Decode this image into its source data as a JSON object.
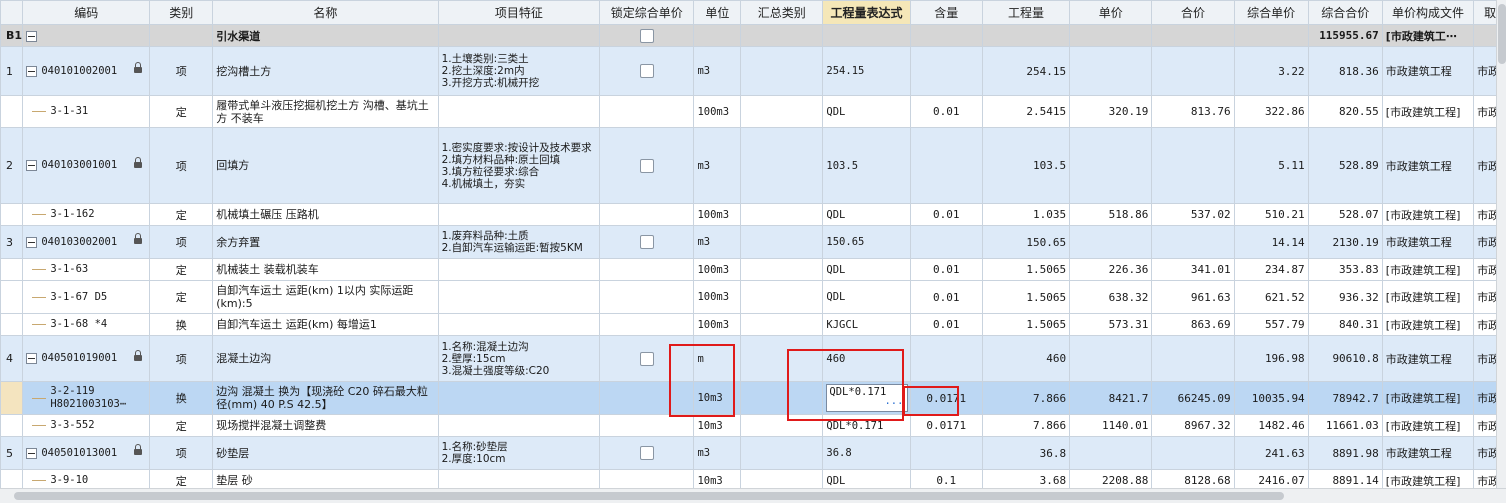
{
  "headers": [
    "编码",
    "类别",
    "名称",
    "项目特征",
    "锁定综合单价",
    "单位",
    "汇总类别",
    "工程量表达式",
    "含量",
    "工程量",
    "单价",
    "合价",
    "综合单价",
    "综合合价",
    "单价构成文件",
    "取费"
  ],
  "group": {
    "seq": "B1",
    "name": "引水渠道",
    "total": "115955.67",
    "file": "[市政建筑工⋯"
  },
  "rows": [
    {
      "seq": "1",
      "code": "040101002001",
      "type": "项",
      "name": "挖沟槽土方",
      "spec": "1.土壤类别:三类土\n2.挖土深度:2m内\n3.开挖方式:机械开挖",
      "unit": "m3",
      "expr": "254.15",
      "content": "",
      "qty": "254.15",
      "price": "",
      "total": "",
      "unitprice": "3.22",
      "uptotal": "818.36",
      "file": "市政建筑工程",
      "fee": "市政建"
    },
    {
      "code": "3-1-31",
      "type": "定",
      "name": "履带式单斗液压挖掘机挖土方 沟槽、基坑土方 不装车",
      "unit": "100m3",
      "expr": "QDL",
      "content": "0.01",
      "qty": "2.5415",
      "price": "320.19",
      "total": "813.76",
      "unitprice": "322.86",
      "uptotal": "820.55",
      "file": "[市政建筑工程]",
      "fee": "市政建"
    },
    {
      "seq": "2",
      "code": "040103001001",
      "type": "项",
      "name": "回填方",
      "spec": "1.密实度要求:按设计及技术要求\n2.填方材料品种:原土回填\n3.填方粒径要求:综合\n4.机械填土，夯实",
      "unit": "m3",
      "expr": "103.5",
      "content": "",
      "qty": "103.5",
      "price": "",
      "total": "",
      "unitprice": "5.11",
      "uptotal": "528.89",
      "file": "市政建筑工程",
      "fee": "市政建"
    },
    {
      "code": "3-1-162",
      "type": "定",
      "name": "机械填土碾压 压路机",
      "unit": "100m3",
      "expr": "QDL",
      "content": "0.01",
      "qty": "1.035",
      "price": "518.86",
      "total": "537.02",
      "unitprice": "510.21",
      "uptotal": "528.07",
      "file": "[市政建筑工程]",
      "fee": "市政建"
    },
    {
      "seq": "3",
      "code": "040103002001",
      "type": "项",
      "name": "余方弃置",
      "spec": "1.废弃料品种:土质\n2.自卸汽车运输运距:暂按5KM",
      "unit": "m3",
      "expr": "150.65",
      "content": "",
      "qty": "150.65",
      "price": "",
      "total": "",
      "unitprice": "14.14",
      "uptotal": "2130.19",
      "file": "市政建筑工程",
      "fee": "市政建"
    },
    {
      "code": "3-1-63",
      "type": "定",
      "name": "机械装土 装载机装车",
      "unit": "100m3",
      "expr": "QDL",
      "content": "0.01",
      "qty": "1.5065",
      "price": "226.36",
      "total": "341.01",
      "unitprice": "234.87",
      "uptotal": "353.83",
      "file": "[市政建筑工程]",
      "fee": "市政建"
    },
    {
      "code": "3-1-67 D5",
      "type": "定",
      "name": "自卸汽车运土 运距(km) 1以内  实际运距(km):5",
      "unit": "100m3",
      "expr": "QDL",
      "content": "0.01",
      "qty": "1.5065",
      "price": "638.32",
      "total": "961.63",
      "unitprice": "621.52",
      "uptotal": "936.32",
      "file": "[市政建筑工程]",
      "fee": "市政建"
    },
    {
      "code": "3-1-68 *4",
      "type": "换",
      "name": "自卸汽车运土 运距(km) 每增运1",
      "unit": "100m3",
      "expr": "KJGCL",
      "content": "0.01",
      "qty": "1.5065",
      "price": "573.31",
      "total": "863.69",
      "unitprice": "557.79",
      "uptotal": "840.31",
      "file": "[市政建筑工程]",
      "fee": "市政建"
    },
    {
      "seq": "4",
      "code": "040501019001",
      "type": "项",
      "name": "混凝土边沟",
      "spec": "1.名称:混凝土边沟\n2.壁厚:15cm\n3.混凝土强度等级:C20",
      "unit": "m",
      "expr": "460",
      "content": "",
      "qty": "460",
      "price": "",
      "total": "",
      "unitprice": "196.98",
      "uptotal": "90610.8",
      "file": "市政建筑工程",
      "fee": "市政建"
    },
    {
      "code": "3-2-119 H8021003103⋯",
      "type": "换",
      "name": "边沟 混凝土  换为【现浇砼 C20 碎石最大粒径(mm) 40 P.S 42.5】",
      "unit": "10m3",
      "expr": "QDL*0.171",
      "content": "0.0171",
      "qty": "7.866",
      "price": "8421.7",
      "total": "66245.09",
      "unitprice": "10035.94",
      "uptotal": "78942.7",
      "file": "[市政建筑工程]",
      "fee": "市政建"
    },
    {
      "code": "3-3-552",
      "type": "定",
      "name": "现场搅拌混凝土调整费",
      "unit": "10m3",
      "expr": "QDL*0.171",
      "content": "0.0171",
      "qty": "7.866",
      "price": "1140.01",
      "total": "8967.32",
      "unitprice": "1482.46",
      "uptotal": "11661.03",
      "file": "[市政建筑工程]",
      "fee": "市政建"
    },
    {
      "seq": "5",
      "code": "040501013001",
      "type": "项",
      "name": "砂垫层",
      "spec": "1.名称:砂垫层\n2.厚度:10cm",
      "unit": "m3",
      "expr": "36.8",
      "content": "",
      "qty": "36.8",
      "price": "",
      "total": "",
      "unitprice": "241.63",
      "uptotal": "8891.98",
      "file": "市政建筑工程",
      "fee": "市政建"
    },
    {
      "code": "3-9-10",
      "type": "定",
      "name": "垫层 砂",
      "unit": "10m3",
      "expr": "QDL",
      "content": "0.1",
      "qty": "3.68",
      "price": "2208.88",
      "total": "8128.68",
      "unitprice": "2416.07",
      "uptotal": "8891.14",
      "file": "[市政建筑工程]",
      "fee": "市政建"
    }
  ],
  "colors": {
    "highlight": "#e01a1a",
    "selected_row": "#bcd7f3",
    "item_row": "#ddeaf8",
    "group_row": "#d6d6d6"
  },
  "icons": [
    "collapse-toggle-icon",
    "lock-icon",
    "ellipsis-icon"
  ]
}
